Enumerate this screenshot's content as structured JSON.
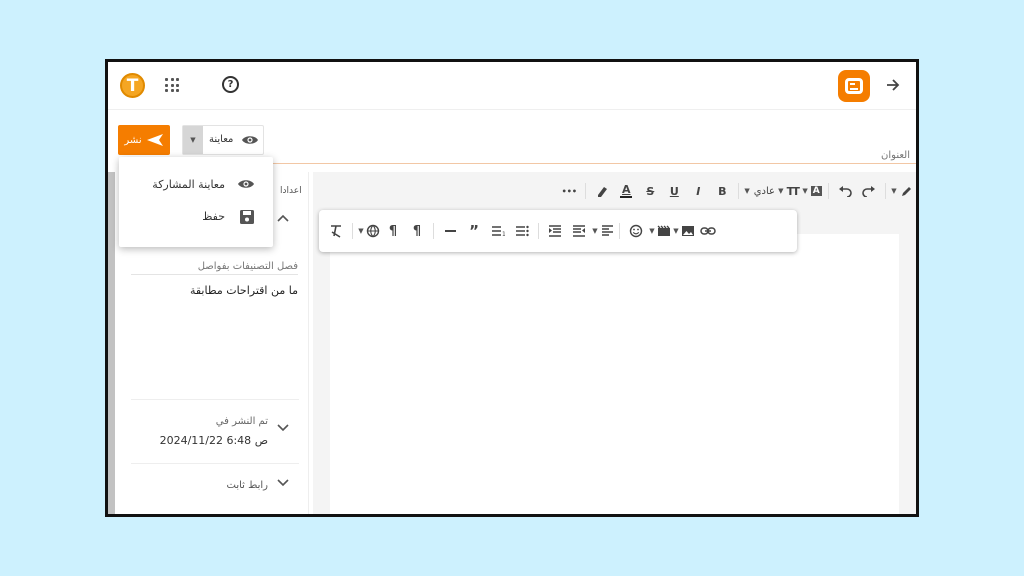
{
  "topbar": {
    "logo_letter": "T",
    "help_symbol": "?",
    "apps_icon": "apps-grid-icon",
    "blogger_icon": "blogger-icon",
    "back_icon": "arrow-right-icon"
  },
  "actions": {
    "publish_label": "نشر",
    "preview_label": "معاينة"
  },
  "title": {
    "placeholder": "العنوان"
  },
  "menu": {
    "items": [
      {
        "label": "معاينة المشاركة",
        "icon": "eye-icon"
      },
      {
        "label": "حفظ",
        "icon": "save-icon"
      }
    ]
  },
  "toolbar": {
    "more_label": "•••",
    "style_select": "عادي",
    "bold": "B",
    "italic": "I",
    "underline": "U",
    "strike": "S",
    "text_color": "A",
    "font_size": "TT"
  },
  "sidebar": {
    "settings_fragment": "اعدادا",
    "labels_placeholder": "فصل التصنيفات بفواصل",
    "no_suggestions": "ما من اقتراحات مطابقة",
    "published_title": "تم النشر في",
    "published_date": "2024/11/22 6:48 ص",
    "permalink_title": "رابط ثابت"
  },
  "colors": {
    "accent": "#f57d00",
    "background": "#cdf1fe"
  }
}
